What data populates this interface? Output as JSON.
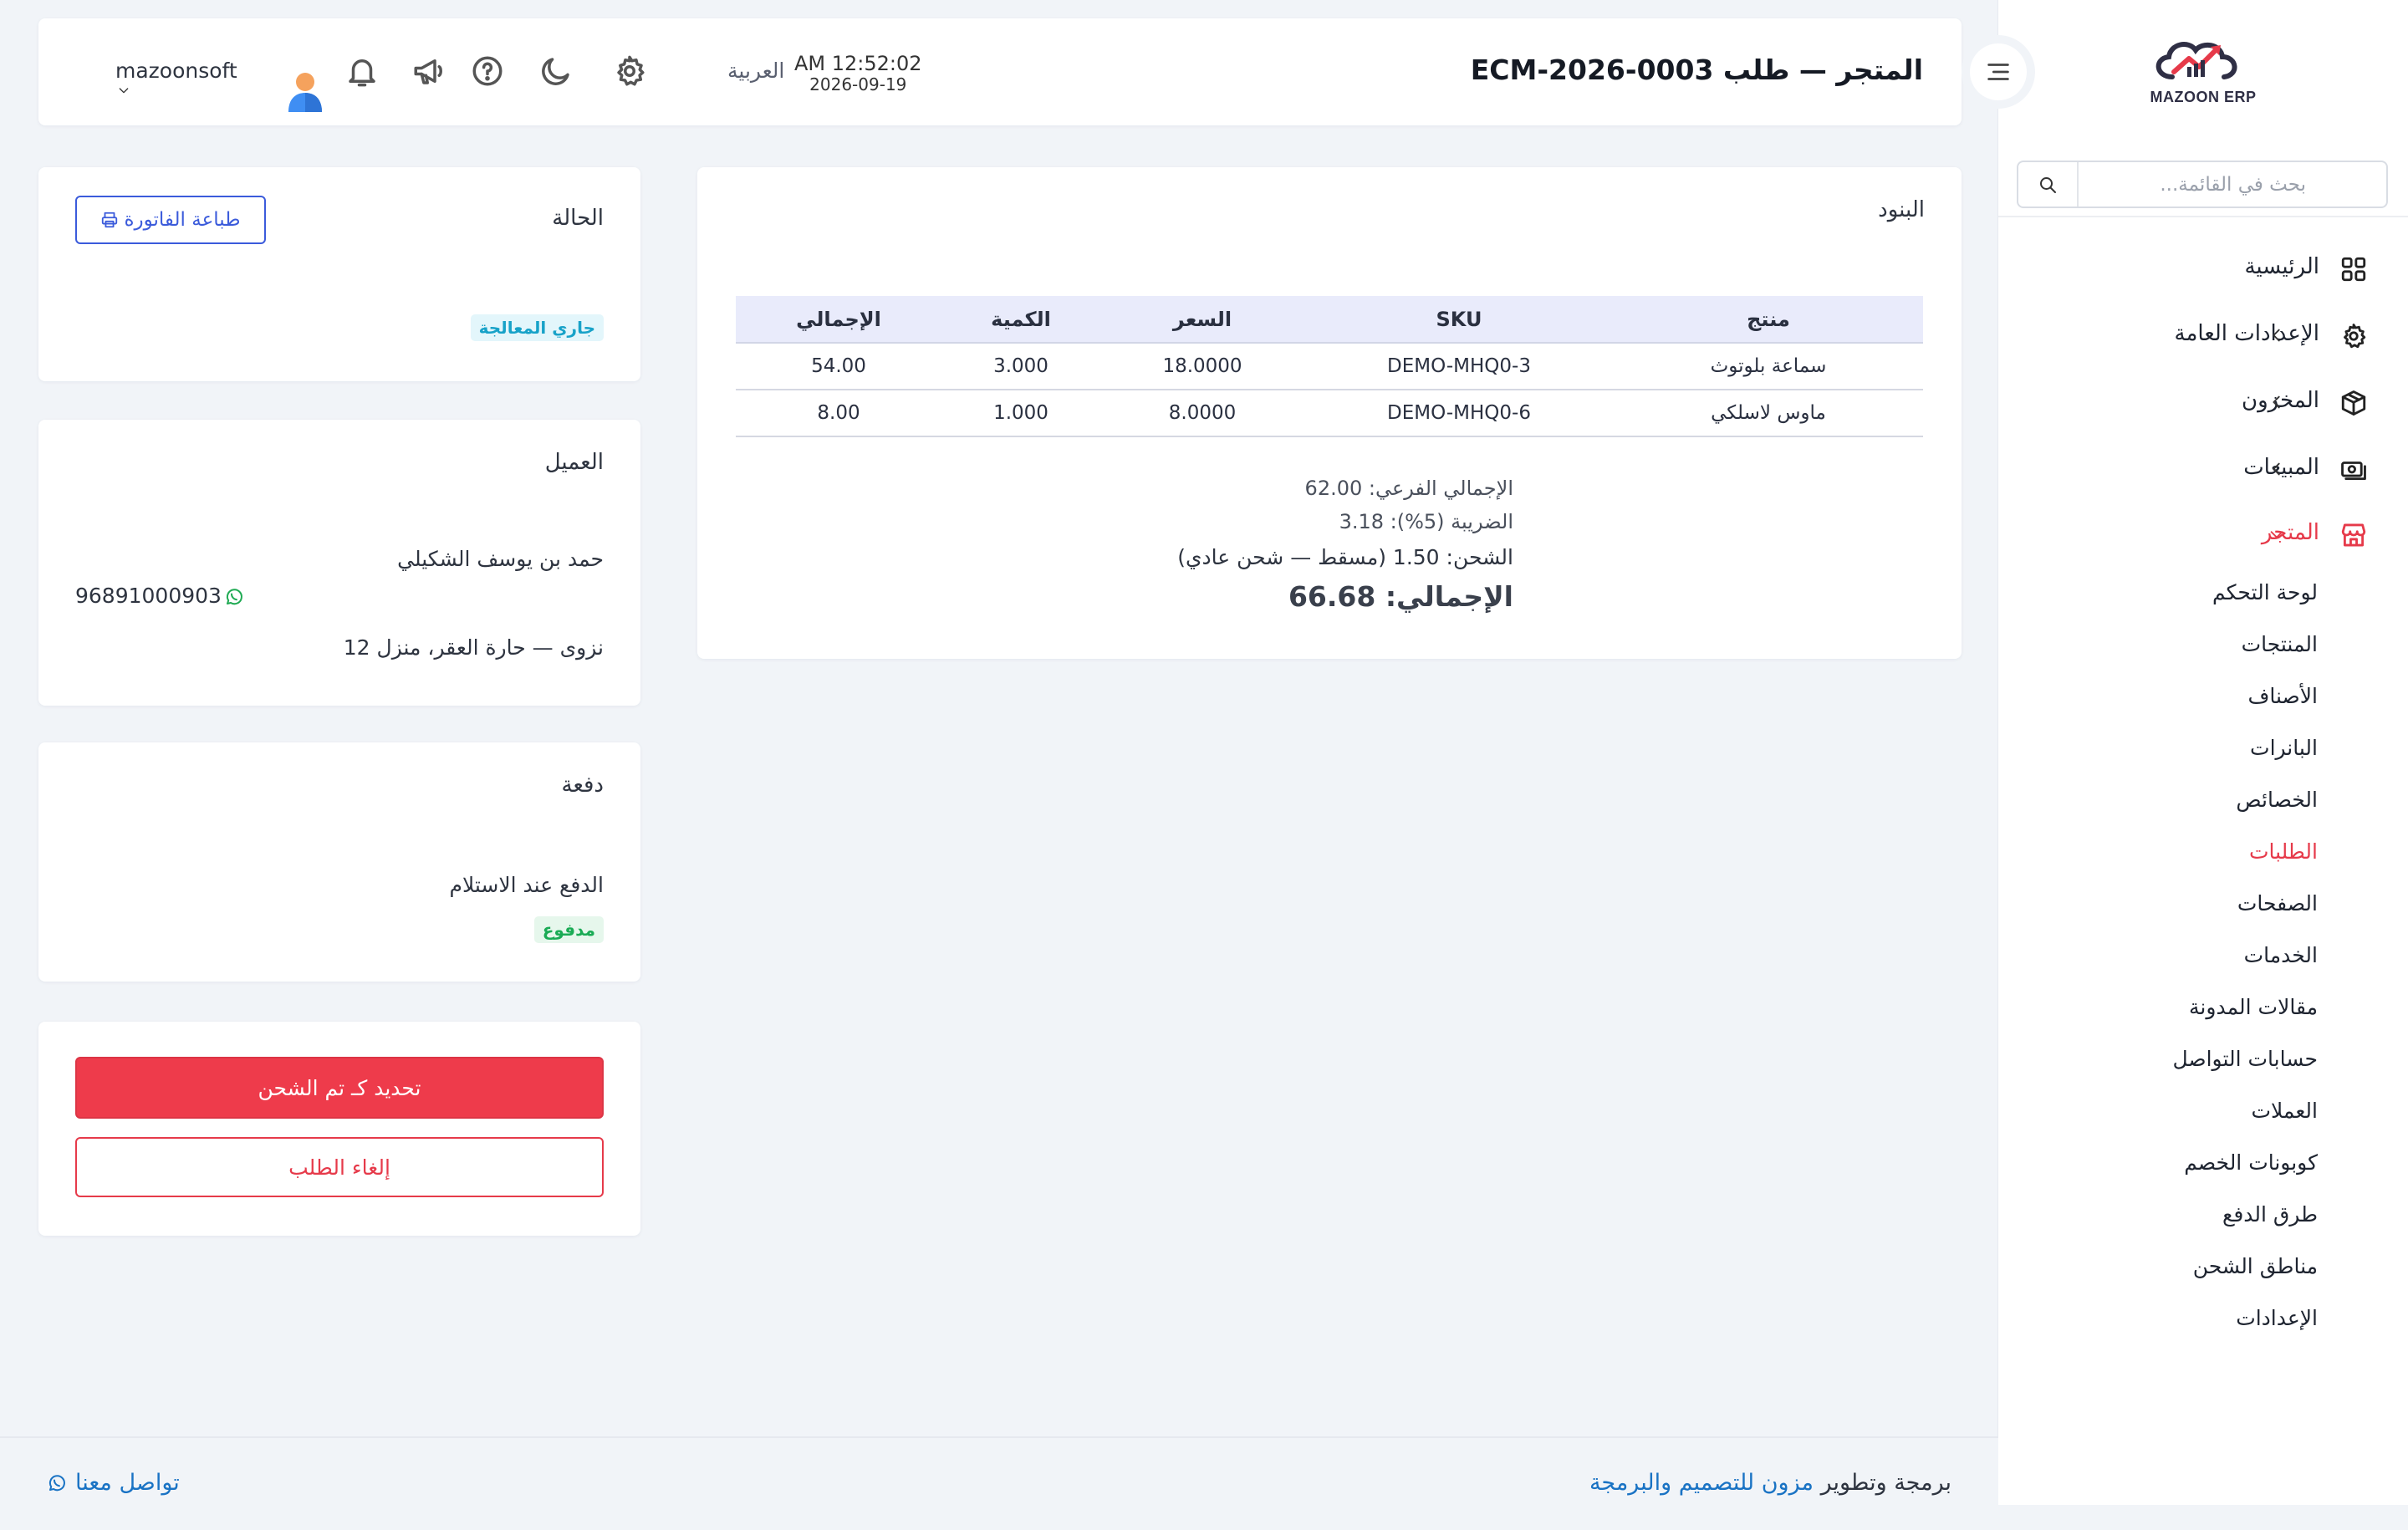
{
  "brand": {
    "logo_text": "MAZOON ERP",
    "logo_small": "ERP ERP"
  },
  "sidebar": {
    "search_placeholder": "بحث في القائمة...",
    "nav": [
      {
        "label": "الرئيسية",
        "icon": "grid-icon",
        "has_chevron": false
      },
      {
        "label": "الإعدادات العامة",
        "icon": "gear-icon",
        "has_chevron": true
      },
      {
        "label": "المخزون",
        "icon": "box-icon",
        "has_chevron": true
      },
      {
        "label": "المبيعات",
        "icon": "cash-icon",
        "has_chevron": true
      },
      {
        "label": "المتجر",
        "icon": "store-icon",
        "has_chevron": true,
        "expanded": true
      }
    ],
    "store_items": [
      "لوحة التحكم",
      "المنتجات",
      "الأصناف",
      "البانرات",
      "الخصائص",
      "الطلبات",
      "الصفحات",
      "الخدمات",
      "مقالات المدونة",
      "حسابات التواصل",
      "العملات",
      "كوبونات الخصم",
      "طرق الدفع",
      "مناطق الشحن",
      "الإعدادات"
    ],
    "active_store_item": "الطلبات"
  },
  "header": {
    "title": "المتجر — طلب ECM-2026-0003",
    "time": "AM 12:52:02",
    "date": "2026-09-19",
    "language": "العربية",
    "username": "mazoonsoft",
    "icons": [
      "gear-icon",
      "moon-icon",
      "help-icon",
      "megaphone-icon",
      "bell-icon"
    ]
  },
  "items_card": {
    "title": "البنود",
    "columns": [
      "منتج",
      "SKU",
      "السعر",
      "الكمية",
      "الإجمالي"
    ],
    "rows": [
      [
        "سماعة بلوتوث",
        "DEMO-MHQ0-3",
        "18.0000",
        "3.000",
        "54.00"
      ],
      [
        "ماوس لاسلكي",
        "DEMO-MHQ0-6",
        "8.0000",
        "1.000",
        "8.00"
      ]
    ],
    "subtotal": "الإجمالي الفرعي: 62.00",
    "tax": "الضريبة (5%): 3.18",
    "shipping": "الشحن: 1.50 (مسقط — شحن عادي)",
    "total": "الإجمالي: 66.68"
  },
  "status_card": {
    "title": "الحالة",
    "print_button": "طباعة الفاتورة",
    "status_badge": "جاري المعالجة"
  },
  "customer_card": {
    "title": "العميل",
    "name": "حمد بن يوسف الشكيلي",
    "phone": "96891000903",
    "address": "نزوى — حارة العقر، منزل 12"
  },
  "payment_card": {
    "title": "دفعة",
    "method": "الدفع عند الاستلام",
    "badge": "مدفوع"
  },
  "actions": {
    "mark_shipped": "تحديد كـ تم الشحن",
    "cancel": "إلغاء الطلب"
  },
  "footer": {
    "credit_prefix": "برمجة وتطوير",
    "credit_link": "مزون للتصميم والبرمجة",
    "contact": "تواصل معنا"
  },
  "colors": {
    "accent": "#e63a4a",
    "primary": "#3b5bdb",
    "link": "#1a73c4",
    "info": "#17a2c8",
    "success": "#1aab55"
  }
}
